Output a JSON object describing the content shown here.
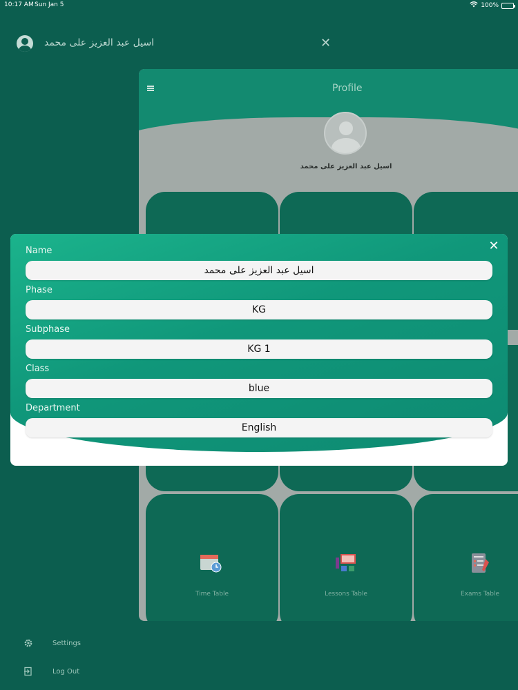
{
  "status_bar": {
    "time": "10:17 AM",
    "date": "Sun Jan 5",
    "battery": "100%"
  },
  "drawer": {
    "user_name": "اسيل عبد العزيز على محمد",
    "close_symbol": "✕",
    "items": [
      {
        "label": "Settings",
        "icon": "gear-icon"
      },
      {
        "label": "Log Out",
        "icon": "logout-icon"
      }
    ]
  },
  "app": {
    "title": "Profile",
    "profile_name": "اسيل عبد العزيز على محمد",
    "tiles": [
      {
        "label": "Time Table",
        "icon": "calendar-clock-icon"
      },
      {
        "label": "Lessons Table",
        "icon": "classroom-icon"
      },
      {
        "label": "Exams Table",
        "icon": "exam-sheet-icon"
      }
    ]
  },
  "dialog": {
    "close_symbol": "✕",
    "fields": [
      {
        "label": "Name",
        "value": "اسيل عبد العزيز على محمد"
      },
      {
        "label": "Phase",
        "value": "KG"
      },
      {
        "label": "Subphase",
        "value": "KG 1"
      },
      {
        "label": "Class",
        "value": "blue"
      },
      {
        "label": "Department",
        "value": "English"
      }
    ]
  },
  "colors": {
    "background": "#0c5e4f",
    "accent": "#1bb38c",
    "tile": "#0e6955"
  }
}
